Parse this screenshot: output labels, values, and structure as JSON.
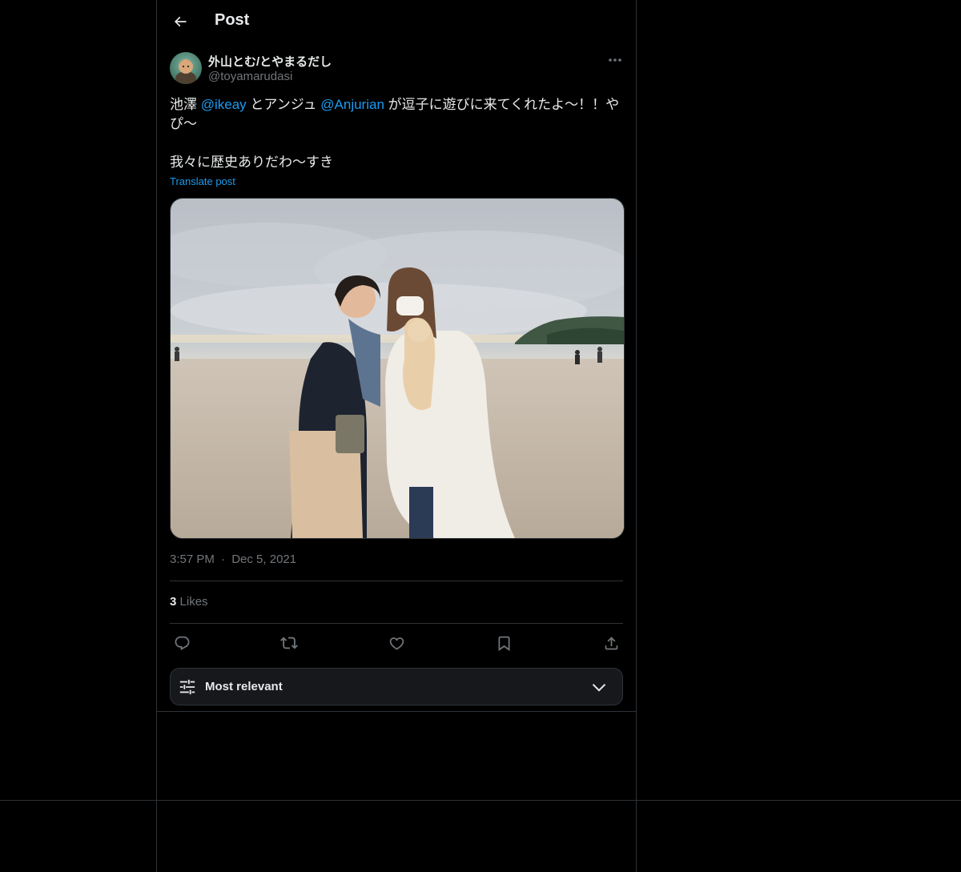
{
  "header": {
    "title": "Post"
  },
  "author": {
    "display_name": "外山とむ/とやまるだし",
    "handle": "@toyamarudasi"
  },
  "tweet": {
    "line1_pre": "池澤 ",
    "mention1": "@ikeay",
    "line1_mid": " とアンジュ ",
    "mention2": "@Anjurian",
    "line1_post": " が逗子に遊びに来てくれたよ〜！！やぴ〜",
    "line2": "我々に歴史ありだわ〜すき",
    "translate_label": "Translate post"
  },
  "meta": {
    "time": "3:57 PM",
    "separator": "·",
    "date": "Dec 5, 2021"
  },
  "stats": {
    "likes_count": "3",
    "likes_label": "Likes"
  },
  "sort": {
    "label": "Most relevant"
  },
  "colors": {
    "background": "#000000",
    "accent": "#1d9bf0",
    "border": "#2f3336",
    "muted": "#71767b"
  },
  "icons": [
    "back-arrow-icon",
    "more-icon",
    "reply-icon",
    "repost-icon",
    "like-icon",
    "bookmark-icon",
    "share-icon",
    "sliders-icon",
    "chevron-down-icon"
  ]
}
